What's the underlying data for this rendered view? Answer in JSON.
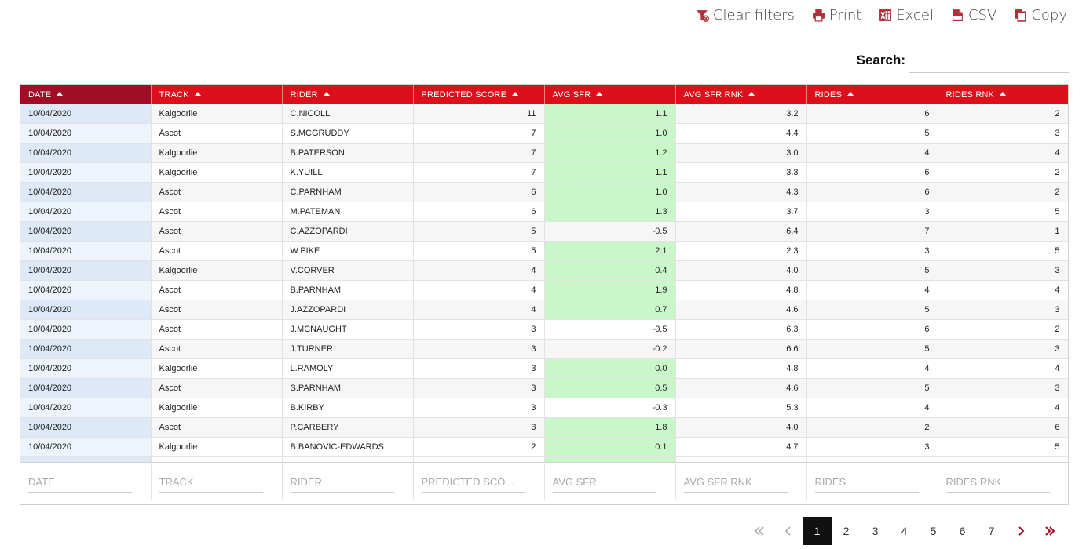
{
  "toolbar": {
    "clear_filters": "Clear filters",
    "print": "Print",
    "excel": "Excel",
    "csv": "CSV",
    "copy": "Copy"
  },
  "search": {
    "label": "Search:",
    "value": ""
  },
  "table": {
    "columns": [
      "DATE",
      "TRACK",
      "RIDER",
      "PREDICTED SCORE",
      "AVG SFR",
      "AVG SFR RNK",
      "RIDES",
      "RIDES RNK"
    ],
    "filter_placeholders": [
      "DATE",
      "TRACK",
      "RIDER",
      "PREDICTED SCO...",
      "AVG SFR",
      "AVG SFR RNK",
      "RIDES",
      "RIDES RNK"
    ],
    "rows": [
      {
        "date": "10/04/2020",
        "track": "Kalgoorlie",
        "rider": "C.NICOLL",
        "score": "11",
        "sfr": "1.1",
        "sfr_rnk": "3.2",
        "rides": "6",
        "rides_rnk": "2",
        "sfr_positive": true
      },
      {
        "date": "10/04/2020",
        "track": "Ascot",
        "rider": "S.MCGRUDDY",
        "score": "7",
        "sfr": "1.0",
        "sfr_rnk": "4.4",
        "rides": "5",
        "rides_rnk": "3",
        "sfr_positive": true
      },
      {
        "date": "10/04/2020",
        "track": "Kalgoorlie",
        "rider": "B.PATERSON",
        "score": "7",
        "sfr": "1.2",
        "sfr_rnk": "3.0",
        "rides": "4",
        "rides_rnk": "4",
        "sfr_positive": true
      },
      {
        "date": "10/04/2020",
        "track": "Kalgoorlie",
        "rider": "K.YUILL",
        "score": "7",
        "sfr": "1.1",
        "sfr_rnk": "3.3",
        "rides": "6",
        "rides_rnk": "2",
        "sfr_positive": true
      },
      {
        "date": "10/04/2020",
        "track": "Ascot",
        "rider": "C.PARNHAM",
        "score": "6",
        "sfr": "1.0",
        "sfr_rnk": "4.3",
        "rides": "6",
        "rides_rnk": "2",
        "sfr_positive": true
      },
      {
        "date": "10/04/2020",
        "track": "Ascot",
        "rider": "M.PATEMAN",
        "score": "6",
        "sfr": "1.3",
        "sfr_rnk": "3.7",
        "rides": "3",
        "rides_rnk": "5",
        "sfr_positive": true
      },
      {
        "date": "10/04/2020",
        "track": "Ascot",
        "rider": "C.AZZOPARDI",
        "score": "5",
        "sfr": "-0.5",
        "sfr_rnk": "6.4",
        "rides": "7",
        "rides_rnk": "1",
        "sfr_positive": false
      },
      {
        "date": "10/04/2020",
        "track": "Ascot",
        "rider": "W.PIKE",
        "score": "5",
        "sfr": "2.1",
        "sfr_rnk": "2.3",
        "rides": "3",
        "rides_rnk": "5",
        "sfr_positive": true
      },
      {
        "date": "10/04/2020",
        "track": "Kalgoorlie",
        "rider": "V.CORVER",
        "score": "4",
        "sfr": "0.4",
        "sfr_rnk": "4.0",
        "rides": "5",
        "rides_rnk": "3",
        "sfr_positive": true
      },
      {
        "date": "10/04/2020",
        "track": "Ascot",
        "rider": "B.PARNHAM",
        "score": "4",
        "sfr": "1.9",
        "sfr_rnk": "4.8",
        "rides": "4",
        "rides_rnk": "4",
        "sfr_positive": true
      },
      {
        "date": "10/04/2020",
        "track": "Ascot",
        "rider": "J.AZZOPARDI",
        "score": "4",
        "sfr": "0.7",
        "sfr_rnk": "4.6",
        "rides": "5",
        "rides_rnk": "3",
        "sfr_positive": true
      },
      {
        "date": "10/04/2020",
        "track": "Ascot",
        "rider": "J.MCNAUGHT",
        "score": "3",
        "sfr": "-0.5",
        "sfr_rnk": "6.3",
        "rides": "6",
        "rides_rnk": "2",
        "sfr_positive": false
      },
      {
        "date": "10/04/2020",
        "track": "Ascot",
        "rider": "J.TURNER",
        "score": "3",
        "sfr": "-0.2",
        "sfr_rnk": "6.6",
        "rides": "5",
        "rides_rnk": "3",
        "sfr_positive": false
      },
      {
        "date": "10/04/2020",
        "track": "Kalgoorlie",
        "rider": "L.RAMOLY",
        "score": "3",
        "sfr": "0.0",
        "sfr_rnk": "4.8",
        "rides": "4",
        "rides_rnk": "4",
        "sfr_positive": true
      },
      {
        "date": "10/04/2020",
        "track": "Ascot",
        "rider": "S.PARNHAM",
        "score": "3",
        "sfr": "0.5",
        "sfr_rnk": "4.6",
        "rides": "5",
        "rides_rnk": "3",
        "sfr_positive": true
      },
      {
        "date": "10/04/2020",
        "track": "Kalgoorlie",
        "rider": "B.KIRBY",
        "score": "3",
        "sfr": "-0.3",
        "sfr_rnk": "5.3",
        "rides": "4",
        "rides_rnk": "4",
        "sfr_positive": false
      },
      {
        "date": "10/04/2020",
        "track": "Ascot",
        "rider": "P.CARBERY",
        "score": "3",
        "sfr": "1.8",
        "sfr_rnk": "4.0",
        "rides": "2",
        "rides_rnk": "6",
        "sfr_positive": true
      },
      {
        "date": "10/04/2020",
        "track": "Kalgoorlie",
        "rider": "B.BANOVIC-EDWARDS",
        "score": "2",
        "sfr": "0.1",
        "sfr_rnk": "4.7",
        "rides": "3",
        "rides_rnk": "5",
        "sfr_positive": true
      }
    ]
  },
  "pagination": {
    "pages": [
      "1",
      "2",
      "3",
      "4",
      "5",
      "6",
      "7"
    ],
    "current": "1"
  },
  "colors": {
    "header_red": "#dd0f1a",
    "sorted_header": "#a00d25",
    "positive_green": "#c9f7c9",
    "icon_red": "#b0303a"
  },
  "icons": [
    "filter-clear-icon",
    "printer-icon",
    "excel-icon",
    "csv-icon",
    "copy-icon",
    "sort-asc-icon",
    "first-page-icon",
    "prev-page-icon",
    "next-page-icon",
    "last-page-icon"
  ]
}
